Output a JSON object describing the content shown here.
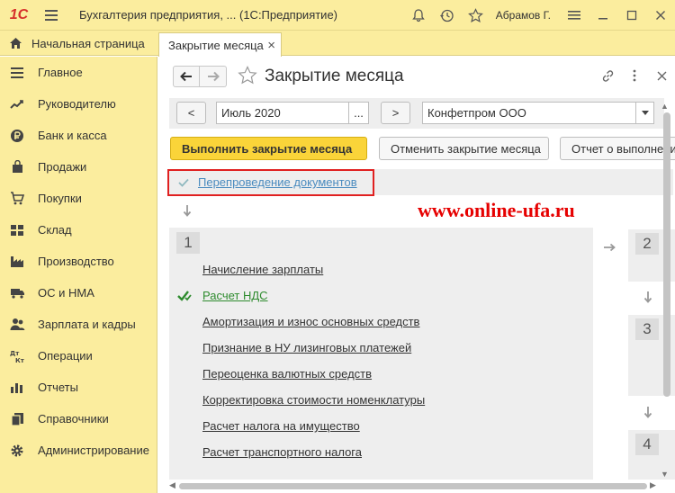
{
  "titlebar": {
    "logo": "1С",
    "app_title": "Бухгалтерия предприятия, ...  (1С:Предприятие)",
    "user_name": "Абрамов Г."
  },
  "tabs": {
    "home_label": "Начальная страница",
    "doc_label": "Закрытие месяца",
    "close_glyph": "×"
  },
  "sidebar": {
    "items": [
      {
        "label": "Главное",
        "icon": "list-icon"
      },
      {
        "label": "Руководителю",
        "icon": "trend-icon"
      },
      {
        "label": "Банк и касса",
        "icon": "coin-icon"
      },
      {
        "label": "Продажи",
        "icon": "bag-icon"
      },
      {
        "label": "Покупки",
        "icon": "cart-icon"
      },
      {
        "label": "Склад",
        "icon": "warehouse-icon"
      },
      {
        "label": "Производство",
        "icon": "factory-icon"
      },
      {
        "label": "ОС и НМА",
        "icon": "truck-icon"
      },
      {
        "label": "Зарплата и кадры",
        "icon": "people-icon"
      },
      {
        "label": "Операции",
        "icon": "dt-kt-icon"
      },
      {
        "label": "Отчеты",
        "icon": "bar-chart-icon"
      },
      {
        "label": "Справочники",
        "icon": "books-icon"
      },
      {
        "label": "Администрирование",
        "icon": "gear-icon"
      }
    ]
  },
  "form": {
    "title": "Закрытие месяца",
    "prev_label": "<",
    "next_label": ">",
    "period_value": "Июль 2020",
    "period_dots": "...",
    "organization_value": "Конфетпром ООО",
    "primary_button": "Выполнить закрытие месяца",
    "cancel_button": "Отменить закрытие месяца",
    "report_button": "Отчет о выполнении",
    "repost_label": "Перепроведение документов"
  },
  "watermark": "www.online-ufa.ru",
  "steps": {
    "step1_number": "1",
    "step1_tasks": [
      {
        "label": "Начисление зарплаты",
        "done": false
      },
      {
        "label": "Расчет НДС",
        "done": true
      },
      {
        "label": "Амортизация и износ основных средств",
        "done": false
      },
      {
        "label": "Признание в НУ лизинговых платежей",
        "done": false
      },
      {
        "label": "Переоценка валютных средств",
        "done": false
      },
      {
        "label": "Корректировка стоимости номенклатуры",
        "done": false
      },
      {
        "label": "Расчет налога на имущество",
        "done": false
      },
      {
        "label": "Расчет транспортного налога",
        "done": false
      }
    ],
    "right_numbers": [
      "2",
      "3",
      "4"
    ]
  },
  "colors": {
    "accent": "#fad439",
    "sidebar_bg": "#fbed9e",
    "link": "#4a8bbf",
    "done": "#2e8b2e",
    "highlight": "#e02020"
  }
}
